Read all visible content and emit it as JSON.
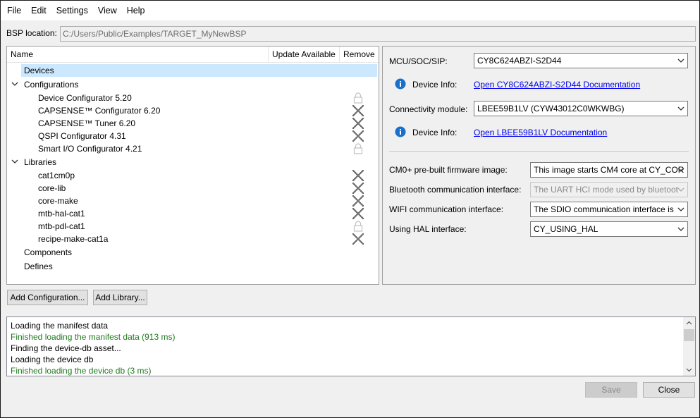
{
  "menu": [
    "File",
    "Edit",
    "Settings",
    "View",
    "Help"
  ],
  "bsp": {
    "label": "BSP location:",
    "path": "C:/Users/Public/Examples/TARGET_MyNewBSP"
  },
  "tree": {
    "columns": {
      "name": "Name",
      "update": "Update Available",
      "remove": "Remove"
    },
    "devices": "Devices",
    "configurations_label": "Configurations",
    "configurations": [
      {
        "label": "Device Configurator 5.20",
        "remove_icon": "lock-icon"
      },
      {
        "label": "CAPSENSE™ Configurator 6.20",
        "remove_icon": "remove-x-icon"
      },
      {
        "label": "CAPSENSE™ Tuner 6.20",
        "remove_icon": "remove-x-icon"
      },
      {
        "label": "QSPI Configurator 4.31",
        "remove_icon": "remove-x-icon"
      },
      {
        "label": "Smart I/O Configurator 4.21",
        "remove_icon": "lock-icon"
      }
    ],
    "libraries_label": "Libraries",
    "libraries": [
      {
        "label": "cat1cm0p",
        "remove_icon": "remove-x-icon"
      },
      {
        "label": "core-lib",
        "remove_icon": "remove-x-icon"
      },
      {
        "label": "core-make",
        "remove_icon": "remove-x-icon"
      },
      {
        "label": "mtb-hal-cat1",
        "remove_icon": "remove-x-icon"
      },
      {
        "label": "mtb-pdl-cat1",
        "remove_icon": "lock-icon"
      },
      {
        "label": "recipe-make-cat1a",
        "remove_icon": "remove-x-icon"
      }
    ],
    "components": "Components",
    "defines": "Defines"
  },
  "device": {
    "mcu_label": "MCU/SOC/SIP:",
    "mcu_value": "CY8C624ABZI-S2D44",
    "info_label": "Device Info:",
    "mcu_link": "Open CY8C624ABZI-S2D44 Documentation",
    "conn_label": "Connectivity module:",
    "conn_value": "LBEE59B1LV (CYW43012C0WKWBG)",
    "conn_link": "Open LBEE59B1LV Documentation"
  },
  "settings": [
    {
      "label": "CM0+ pre-built firmware image:",
      "value": "This image starts CM4 core at CY_COR",
      "disabled": false
    },
    {
      "label": "Bluetooth communication interface:",
      "value": "The UART HCI mode used by bluetoot",
      "disabled": true
    },
    {
      "label": "WIFI communication interface:",
      "value": "The SDIO communication interface is",
      "disabled": false
    },
    {
      "label": "Using HAL interface:",
      "value": "CY_USING_HAL",
      "disabled": false
    }
  ],
  "buttons": {
    "add_configuration": "Add Configuration...",
    "add_library": "Add Library...",
    "save": "Save",
    "close": "Close"
  },
  "log": [
    {
      "text": "Loading the manifest data",
      "color": "#000000"
    },
    {
      "text": "Finished loading the manifest data (913 ms)",
      "color": "#1e7a1e"
    },
    {
      "text": "Finding the device-db asset...",
      "color": "#000000"
    },
    {
      "text": "Loading the device db",
      "color": "#000000"
    },
    {
      "text": "Finished loading the device db (3 ms)",
      "color": "#1e7a1e"
    }
  ],
  "colors": {
    "selection": "#cce8ff",
    "link": "#0000ee",
    "info_icon": "#1a6fc9",
    "success_text": "#1e7a1e"
  }
}
